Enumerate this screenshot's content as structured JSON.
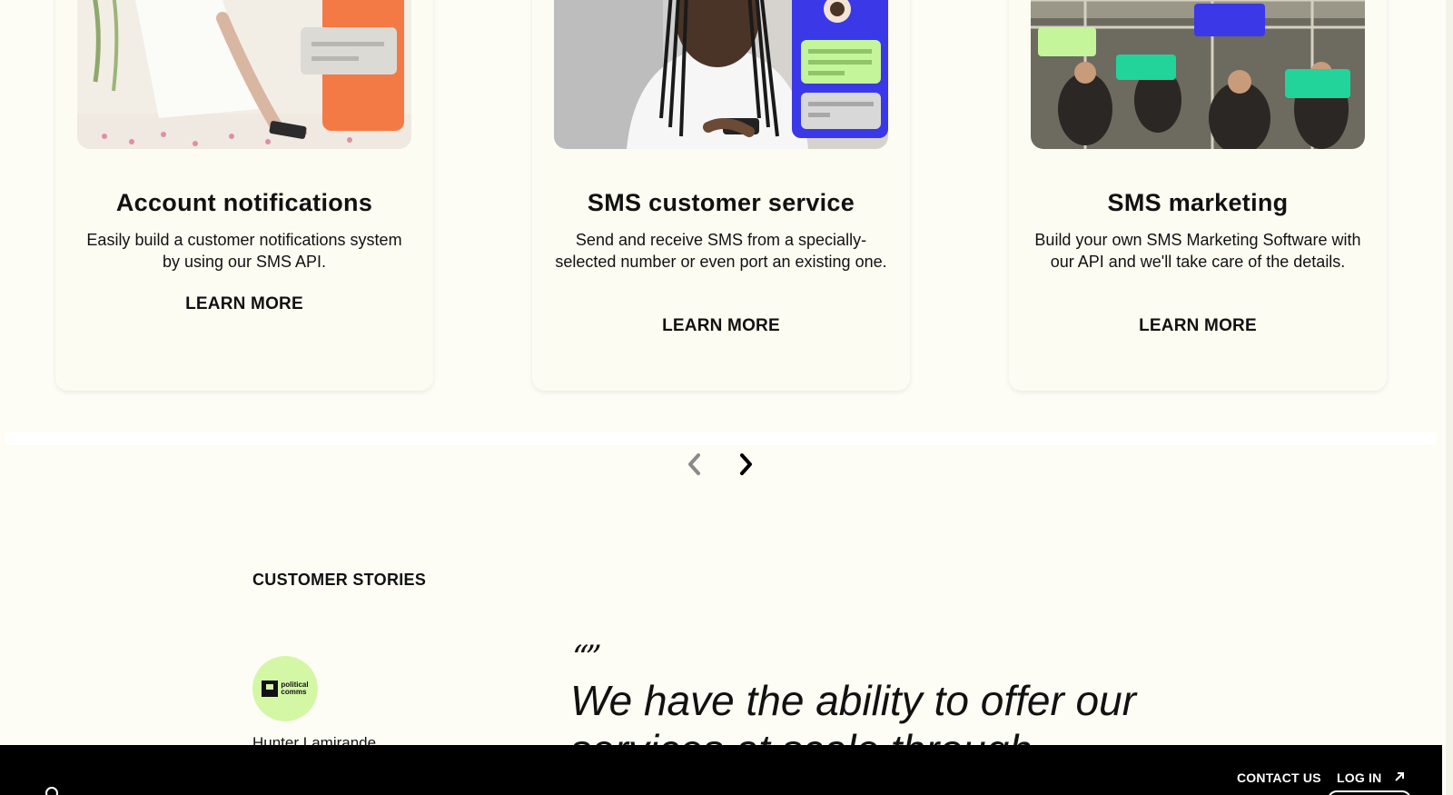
{
  "cards": [
    {
      "title": "Account notifications",
      "description": "Easily build a customer notifications system by using our SMS API.",
      "cta": "LEARN MORE"
    },
    {
      "title": "SMS customer service",
      "description": "Send and receive SMS from a specially-selected number or even port an existing one.",
      "cta": "LEARN MORE"
    },
    {
      "title": "SMS marketing",
      "description": "Build your own SMS Marketing Software with our API and we'll take care of the details.",
      "cta": "LEARN MORE"
    }
  ],
  "carousel": {
    "prev_icon": "chevron-left-icon",
    "next_icon": "chevron-right-icon"
  },
  "stories": {
    "section_label": "CUSTOMER STORIES",
    "logo_text_line1": "political",
    "logo_text_line2": "comms",
    "person_name": "Hunter Lamirande",
    "quote_mark": "“”",
    "quote": "We have the ability to offer our services at scale through"
  },
  "footer": {
    "contact": "CONTACT US",
    "login": "LOG IN",
    "login_icon": "arrow-up-right-icon"
  },
  "colors": {
    "background": "#fdfdf6",
    "logo_bg": "#d4f7a6",
    "footer_bg": "#000000",
    "chat_blue": "#3b38e8",
    "chat_green": "#c4f59a",
    "chat_teal": "#22d39a",
    "chat_orange": "#f47a45"
  }
}
